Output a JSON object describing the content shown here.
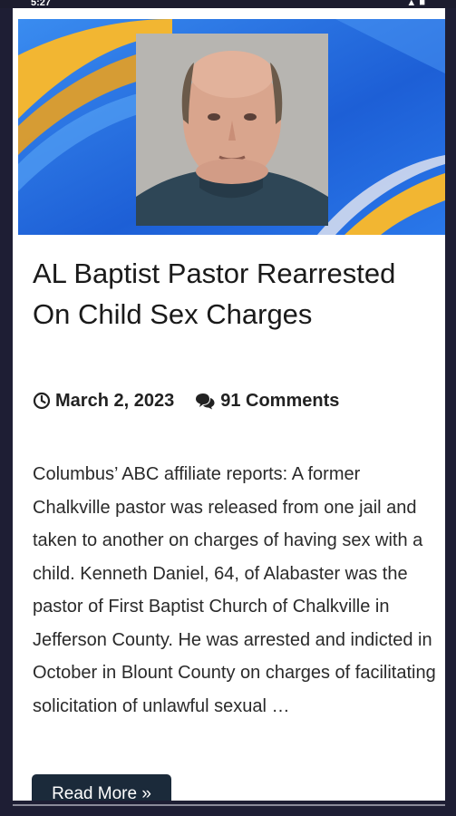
{
  "status_bar": {
    "time": "5:27",
    "right": "▲ ■"
  },
  "article": {
    "title": "AL Baptist Pastor Rearrested On Child Sex Charges",
    "date": "March 2, 2023",
    "comments": "91 Comments",
    "excerpt": "Columbus’ ABC affiliate reports: A former Chalkville pastor was released from one jail and taken to another on charges of having sex with a child. Kenneth Daniel, 64, of Alabaster was the pastor of First Baptist Church of Chalkville in Jefferson County. He was arrested and indicted in October in Blount County on charges of facilitating solicitation of unlawful sexual …",
    "read_more": "Read More »"
  },
  "icons": {
    "clock": "clock-icon",
    "comments": "comments-icon"
  },
  "colors": {
    "page_bg": "#1e1e34",
    "hero_blue": "#1f63d8",
    "hero_gold": "#f2b632",
    "button_bg": "#1b2a3a",
    "text": "#1a1a1a"
  }
}
